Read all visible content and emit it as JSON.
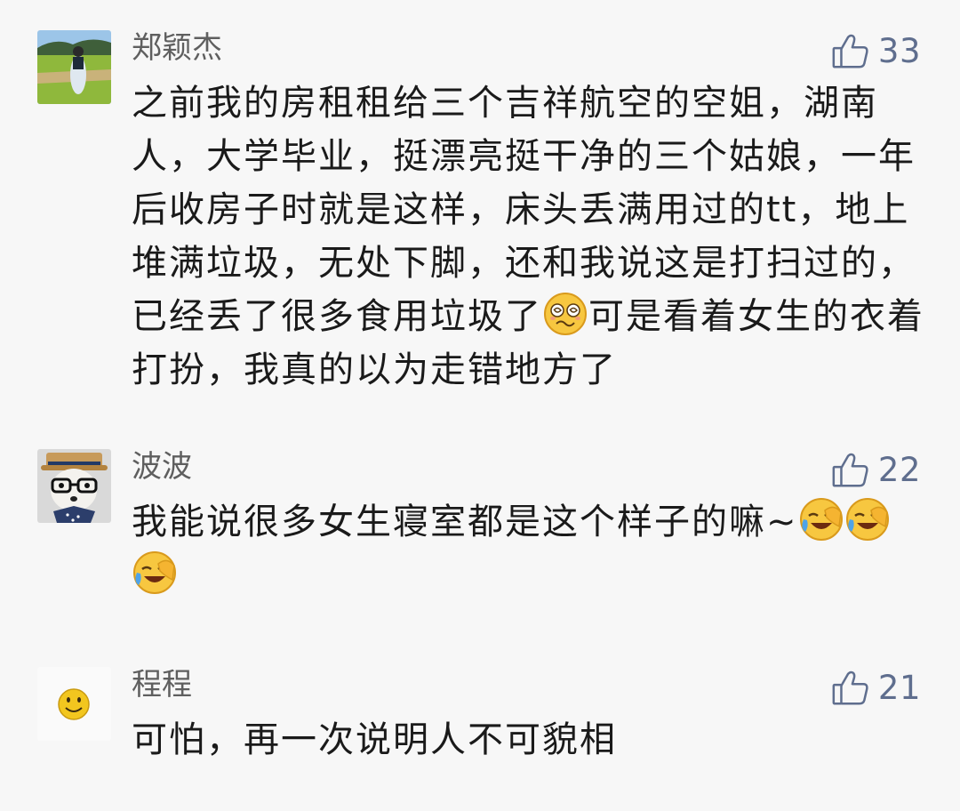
{
  "comments": [
    {
      "username": "郑颖杰",
      "likes": "33",
      "content_parts": [
        "之前我的房租租给三个吉祥航空的空姐，湖南人，大学毕业，挺漂亮挺干净的三个姑娘，一年后收房子时就是这样，床头丢满用过的tt，地上堆满垃圾，无处下脚，还和我说这是打扫过的，已经丢了很多食用垃圾了",
        "可是看着女生的衣着打扮，我真的以为走错地方了"
      ],
      "emoji": "dizzy-face-emoji"
    },
    {
      "username": "波波",
      "likes": "22",
      "content_parts": [
        "我能说很多女生寝室都是这个样子的嘛~"
      ],
      "emoji": "facepalm-laugh-emoji"
    },
    {
      "username": "程程",
      "likes": "21",
      "content_parts": [
        "可怕，再一次说明人不可貌相"
      ]
    }
  ],
  "icons": {
    "like": "thumbs-up-icon"
  },
  "colors": {
    "background": "#f7f7f7",
    "username": "#5f5f5f",
    "like": "#5f6e8e",
    "text": "#1a1a1a"
  }
}
